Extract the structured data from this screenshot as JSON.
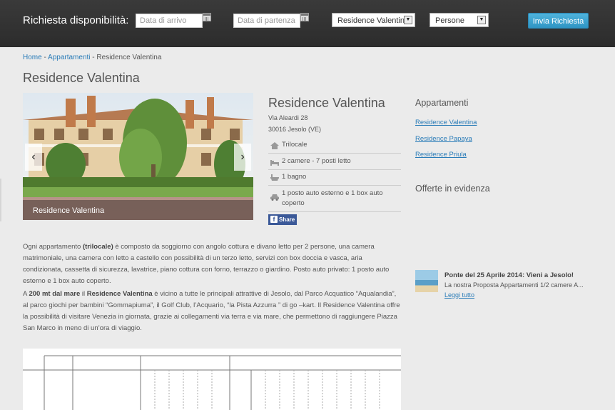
{
  "search_bar": {
    "label": "Richiesta disponibilità:",
    "arrival_placeholder": "Data di arrivo",
    "departure_placeholder": "Data di partenza",
    "residence_selected": "Residence Valentina",
    "persons_selected": "Persone",
    "submit_label": "Invia Richiesta"
  },
  "breadcrumb": {
    "home": "Home",
    "separator": " - ",
    "section": "Appartamenti",
    "current": "Residence Valentina"
  },
  "page_title": "Residence Valentina",
  "gallery": {
    "caption": "Residence Valentina",
    "prev": "‹",
    "next": "›"
  },
  "info": {
    "title": "Residence Valentina",
    "address_line1": "Via Aleardi 28",
    "address_line2": "30016 Jesolo (VE)",
    "features": [
      {
        "icon": "house-icon",
        "text": "Trilocale"
      },
      {
        "icon": "bed-icon",
        "text": "2 camere - 7 posti letto"
      },
      {
        "icon": "bathtub-icon",
        "text": "1 bagno"
      },
      {
        "icon": "car-icon",
        "text_line1": "1 posto auto esterno e 1 box auto",
        "text_line2": "coperto"
      }
    ],
    "share_label": "Share"
  },
  "sidebar": {
    "apartments_heading": "Appartamenti",
    "apartments": [
      "Residence Valentina",
      "Residence Papaya",
      "Residence Priula"
    ],
    "offers_heading": "Offerte in evidenza",
    "offer": {
      "title": "Ponte del 25 Aprile 2014: Vieni a Jesolo!",
      "excerpt": "La nostra Proposta Appartamenti 1/2 camere A...",
      "more": "Leggi tutto"
    }
  },
  "description": {
    "p1": {
      "a": "Ogni appartamento ",
      "b": "(trilocale)",
      "c": " è composto da soggiorno con angolo cottura e divano letto per 2 persone, una camera matrimoniale, una camera con letto a castello con possibilità di un terzo letto, servizi con box doccia e vasca, aria condizionata, cassetta di sicurezza, lavatrice, piano cottura con forno, terrazzo o giardino. Posto auto privato: 1 posto auto esterno e 1 box auto coperto."
    },
    "p2": {
      "a": "A ",
      "b": "200 mt dal mare",
      "c": " il ",
      "d": "Residence Valentina",
      "e": " è vicino a tutte le principali attrattive di Jesolo, dal Parco Acquatico “Aqualandia”, al parco giochi per bambini “Gommapiuma”, il Golf Club, l’Acquario, “la Pista Azzurra ” di go –kart. Il Residence Valentina offre la possibilità di visitare Venezia in giornata, grazie ai collegamenti via terra e via mare, che permettono di raggiungere Piazza San Marco in meno di un’ora di viaggio."
    }
  },
  "colors": {
    "topbar": "#333333",
    "link": "#2a7cb8",
    "button": "#3aa3d0",
    "background": "#ebebeb",
    "facebook": "#3b5998"
  }
}
